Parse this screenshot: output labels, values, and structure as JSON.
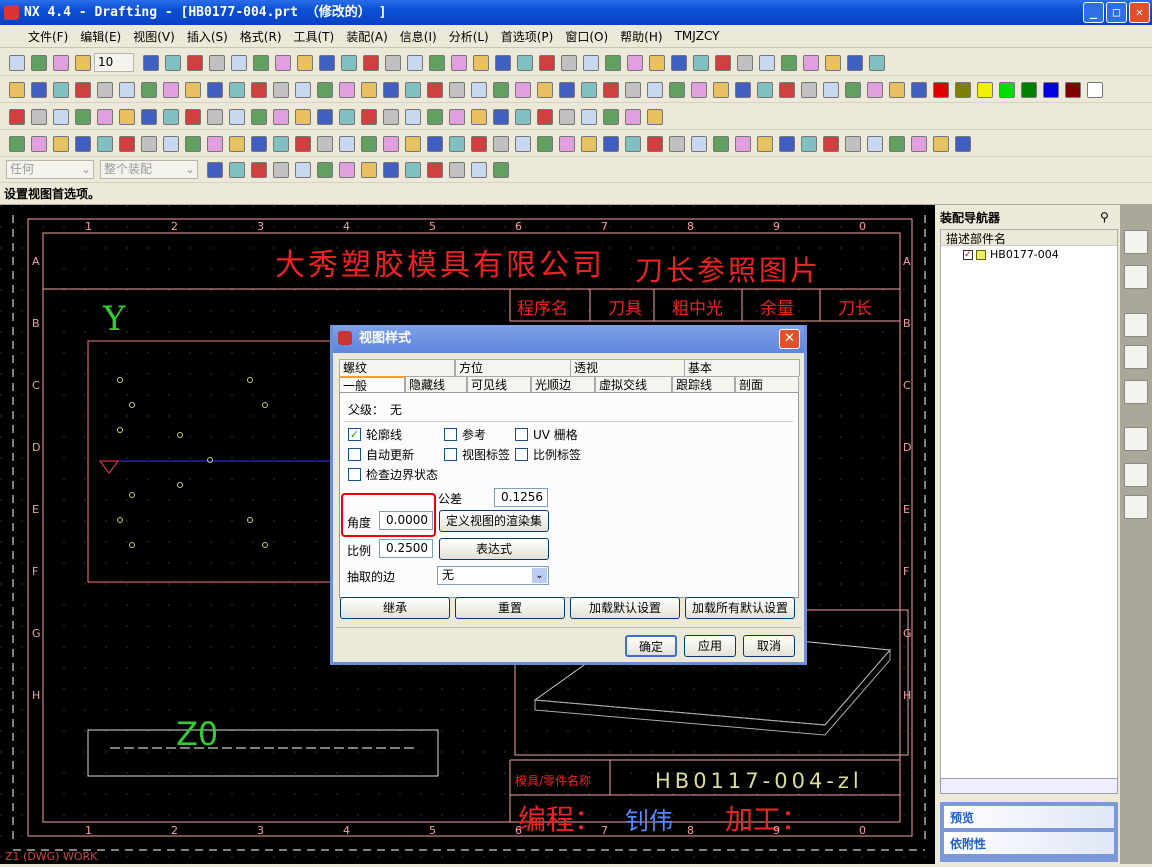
{
  "window": {
    "title": "NX 4.4 - Drafting - [HB0177-004.prt （修改的） ]",
    "minimize": "_",
    "maximize": "□",
    "close": "✕"
  },
  "menu": [
    "文件(F)",
    "编辑(E)",
    "视图(V)",
    "插入(S)",
    "格式(R)",
    "工具(T)",
    "装配(A)",
    "信息(I)",
    "分析(L)",
    "首选项(P)",
    "窗口(O)",
    "帮助(H)",
    "TMJZCY"
  ],
  "toolbar": {
    "font_size": "10",
    "filter_type": "任何",
    "filter_scope": "整个装配",
    "colors": [
      "#e00000",
      "#808000",
      "#f0f000",
      "#00e000",
      "#008000",
      "#0000e0",
      "#800000",
      "#ffffff"
    ]
  },
  "status": "设置视图首选项。",
  "drawing": {
    "company": "大秀塑胶模具有限公司",
    "title": "刀长参照图片",
    "columns": [
      "程序名",
      "刀具",
      "粗中光",
      "余量",
      "刀长"
    ],
    "part_label": "模具/零件名称",
    "part_name": "HB0117-004-zl",
    "programmer_label": "编程：",
    "programmer": "钊伟",
    "machining_label": "加工：",
    "axis_y": "Y",
    "view_label": "Z0",
    "col_numbers": [
      "1",
      "2",
      "3",
      "4",
      "5",
      "6",
      "7",
      "8",
      "9",
      "0"
    ],
    "row_letters": [
      "A",
      "B",
      "C",
      "D",
      "E",
      "F",
      "G",
      "H"
    ],
    "status_text": "Z1 (DWG) WORK"
  },
  "navigator": {
    "title": "装配导航器",
    "column": "描述部件名",
    "item": "HB0177-004",
    "item_checked": true,
    "preview": "预览",
    "dependency": "依附性"
  },
  "dialog": {
    "title": "视图样式",
    "tabs_row1": [
      "螺纹",
      "方位",
      "透视",
      "基本"
    ],
    "tabs_row2": [
      "一般",
      "隐藏线",
      "可见线",
      "光顺边",
      "虚拟交线",
      "跟踪线",
      "剖面"
    ],
    "active_tab": "一般",
    "parent_label": "父级：",
    "parent_value": "无",
    "checkboxes": [
      {
        "label": "轮廓线",
        "checked": true
      },
      {
        "label": "参考",
        "checked": false
      },
      {
        "label": "UV 栅格",
        "checked": false
      },
      {
        "label": "自动更新",
        "checked": false
      },
      {
        "label": "视图标签",
        "checked": false
      },
      {
        "label": "比例标签",
        "checked": false
      },
      {
        "label": "检查边界状态",
        "checked": false
      }
    ],
    "tolerance_label": "公差",
    "tolerance": "0.1256",
    "angle_label": "角度",
    "angle": "0.0000",
    "render_set": "定义视图的渲染集",
    "scale_label": "比例",
    "scale": "0.2500",
    "expression": "表达式",
    "extract_label": "抽取的边",
    "extract_value": "无",
    "inherit": "继承",
    "reset": "重置",
    "load_defaults": "加载默认设置",
    "load_all_defaults": "加载所有默认设置",
    "ok": "确定",
    "apply": "应用",
    "cancel": "取消"
  }
}
